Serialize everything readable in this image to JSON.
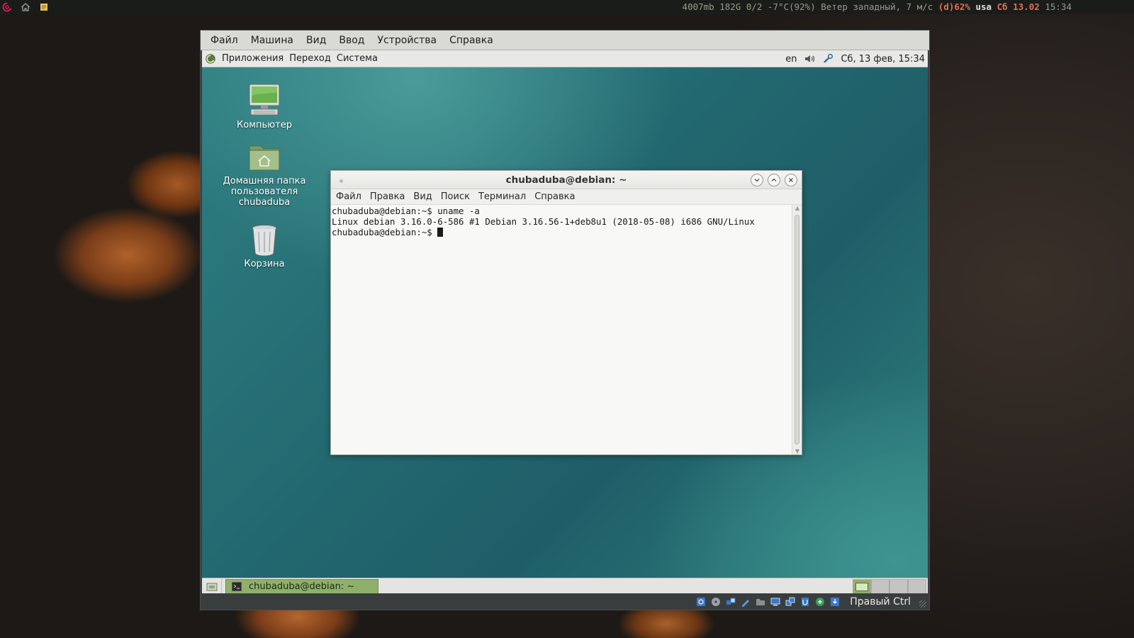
{
  "host": {
    "status": {
      "mem": "4007mb",
      "disk": "182G",
      "ws": "0/2",
      "weather": "-7°C(92%) Ветер западный, 7 м/с",
      "battery": "(d)62%",
      "layout": "usa",
      "date": "Сб 13.02",
      "time": "15:34"
    }
  },
  "vm": {
    "menu": [
      "Файл",
      "Машина",
      "Вид",
      "Ввод",
      "Устройства",
      "Справка"
    ],
    "host_key": "Правый Ctrl"
  },
  "guest": {
    "top_panel": {
      "menus": [
        "Приложения",
        "Переход",
        "Система"
      ],
      "keyboard_layout": "en",
      "clock": "Сб, 13 фев, 15:34"
    },
    "desktop_icons": [
      {
        "label": "Компьютер"
      },
      {
        "label": "Домашняя папка пользователя chubaduba"
      },
      {
        "label": "Корзина"
      }
    ],
    "terminal": {
      "title": "chubaduba@debian: ~",
      "menu": [
        "Файл",
        "Правка",
        "Вид",
        "Поиск",
        "Терминал",
        "Справка"
      ],
      "lines": [
        "chubaduba@debian:~$ uname -a",
        "Linux debian 3.16.0-6-586 #1 Debian 3.16.56-1+deb8u1 (2018-05-08) i686 GNU/Linux",
        "chubaduba@debian:~$ "
      ]
    },
    "taskbar": {
      "task_label": "chubaduba@debian: ~"
    }
  },
  "colors": {
    "taskbar_active": "#8fb06a",
    "desktop_teal": "#2f7f82"
  }
}
